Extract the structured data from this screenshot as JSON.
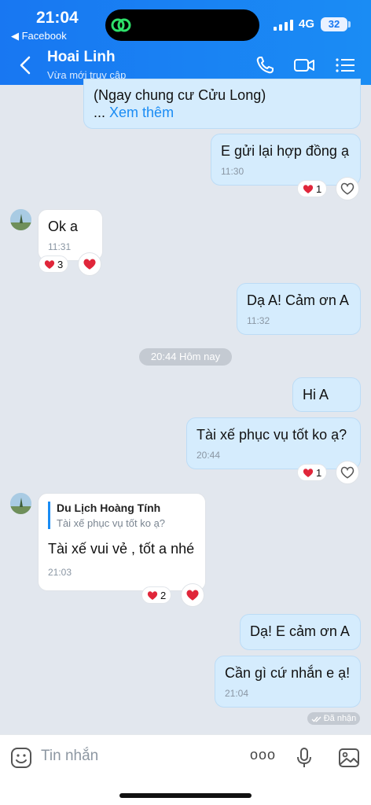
{
  "status_bar": {
    "time": "21:04",
    "back_label": "◀ Facebook",
    "network": "4G",
    "battery": "32"
  },
  "header": {
    "name": "Hoai Linh",
    "status": "Vừa mới truy cập"
  },
  "messages": {
    "m0": {
      "text": "(Ngay chung cư Cửu Long)",
      "ellipsis": "...",
      "see_more": "Xem thêm"
    },
    "m1": {
      "text": "E gửi lại hợp đồng ạ",
      "time": "11:30",
      "reaction_count": "1"
    },
    "m2": {
      "text": "Ok a",
      "time": "11:31",
      "reaction_count": "3"
    },
    "m3": {
      "text": "Dạ A! Cảm ơn A",
      "time": "11:32"
    },
    "divider": "20:44 Hôm nay",
    "m4": {
      "text": "Hi A"
    },
    "m5": {
      "text": "Tài xế phục vụ tốt ko ạ?",
      "time": "20:44",
      "reaction_count": "1"
    },
    "m6": {
      "quote_author": "Du Lịch Hoàng Tính",
      "quote_text": "Tài xế phục vụ tốt ko ạ?",
      "text": "Tài xế vui vẻ , tốt a nhé",
      "time": "21:03",
      "reaction_count": "2"
    },
    "m7": {
      "text": "Dạ! E cảm ơn A"
    },
    "m8": {
      "text": "Cần gì cứ nhắn e ạ!",
      "time": "21:04"
    },
    "seen": "Đã nhận"
  },
  "composer": {
    "placeholder": "Tin nhắn",
    "more_label": "ooo"
  },
  "colors": {
    "accent": "#1877f2",
    "heart": "#e0263a",
    "mine_bubble": "#d5ecfd"
  },
  "icons": [
    "phone-icon",
    "video-call-icon",
    "menu-icon",
    "sticker-icon",
    "microphone-icon",
    "image-icon",
    "heart-icon",
    "heart-outline-icon",
    "back-arrow-icon",
    "double-check-icon"
  ]
}
